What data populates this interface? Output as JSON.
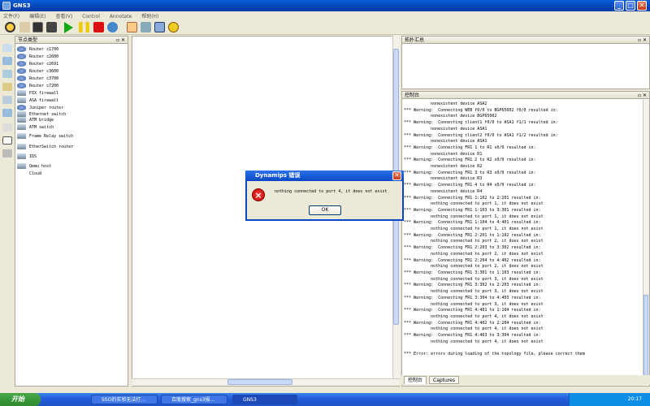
{
  "window": {
    "title": "GNS3",
    "min": "_",
    "max": "□",
    "close": "✕"
  },
  "menu": [
    "文件(F)",
    "编辑(E)",
    "查看(V)",
    "Control",
    "Annotate",
    "帮助(H)"
  ],
  "toolbar": [
    "new-icon",
    "open-icon",
    "console-icon",
    "terminal-icon",
    "start-icon",
    "pause-icon",
    "stop-icon",
    "reload-icon",
    "note-icon",
    "screenshot-icon",
    "rectangle-icon",
    "ellipse-icon"
  ],
  "node_panel": {
    "title": "节点类型",
    "items": [
      "Router c1700",
      "Router c2600",
      "Router c2691",
      "Router c3600",
      "Router c3700",
      "Router c7200",
      "PIX firewall",
      "ASA firewall",
      "Juniper router",
      "Ethernet switch",
      "ATM bridge",
      "ATM switch",
      "Frame Relay switch",
      "EtherSwitch router",
      "IDS",
      "Qemu host",
      "Cloud"
    ]
  },
  "topo_panel": {
    "title": "拓扑汇总"
  },
  "console_panel": {
    "title": "控制台",
    "lines": [
      "           nonexistent device ASA2",
      "*** Warning:  Connecting WEB f0/0 to BGP65002 f0/0 resulted in:",
      "           nonexistent device BGP65002",
      "*** Warning:  Connecting client1 f0/0 to ASA1 f1/1 resulted in:",
      "           nonexistent device ASA1",
      "*** Warning:  Connecting client2 f0/0 to ASA1 f1/2 resulted in:",
      "           nonexistent device ASA1",
      "*** Warning:  Connecting FR1 1 to R1 s0/0 resulted in:",
      "           nonexistent device R1",
      "*** Warning:  Connecting FR1 2 to R2 s0/0 resulted in:",
      "           nonexistent device R2",
      "*** Warning:  Connecting FR1 3 to R3 s0/0 resulted in:",
      "           nonexistent device R3",
      "*** Warning:  Connecting FR1 4 to R4 s0/0 resulted in:",
      "           nonexistent device R4",
      "*** Warning:  Connecting FR1 1:102 to 2:201 resulted in:",
      "           nothing connected to port 1, it does not exist",
      "*** Warning:  Connecting FR1 1:103 to 3:301 resulted in:",
      "           nothing connected to port 1, it does not exist",
      "*** Warning:  Connecting FR1 1:104 to 4:401 resulted in:",
      "           nothing connected to port 1, it does not exist",
      "*** Warning:  Connecting FR1 2:201 to 1:102 resulted in:",
      "           nothing connected to port 2, it does not exist",
      "*** Warning:  Connecting FR1 2:203 to 3:302 resulted in:",
      "           nothing connected to port 2, it does not exist",
      "*** Warning:  Connecting FR1 2:204 to 4:402 resulted in:",
      "           nothing connected to port 2, it does not exist",
      "*** Warning:  Connecting FR1 3:301 to 1:103 resulted in:",
      "           nothing connected to port 3, it does not exist",
      "*** Warning:  Connecting FR1 3:302 to 2:203 resulted in:",
      "           nothing connected to port 3, it does not exist",
      "*** Warning:  Connecting FR1 3:304 to 4:403 resulted in:",
      "           nothing connected to port 3, it does not exist",
      "*** Warning:  Connecting FR1 4:401 to 1:104 resulted in:",
      "           nothing connected to port 4, it does not exist",
      "*** Warning:  Connecting FR1 4:402 to 2:204 resulted in:",
      "           nothing connected to port 4, it does not exist",
      "*** Warning:  Connecting FR1 4:403 to 3:304 resulted in:",
      "           nothing connected to port 4, it does not exist",
      "",
      "*** Error: errors during loading of the topology file, please correct them"
    ],
    "tabs": [
      "控制台",
      "Captures"
    ]
  },
  "dialog": {
    "title": "Dynamips 错误",
    "message": "nothing connected to port 4, it does not exist",
    "ok": "OK",
    "close": "✕"
  },
  "taskbar": {
    "start": "开始",
    "tasks": [
      "SSO的实验无法打...",
      "百度搜索_gns3报...",
      "GNS3"
    ],
    "clock": "20:17"
  }
}
